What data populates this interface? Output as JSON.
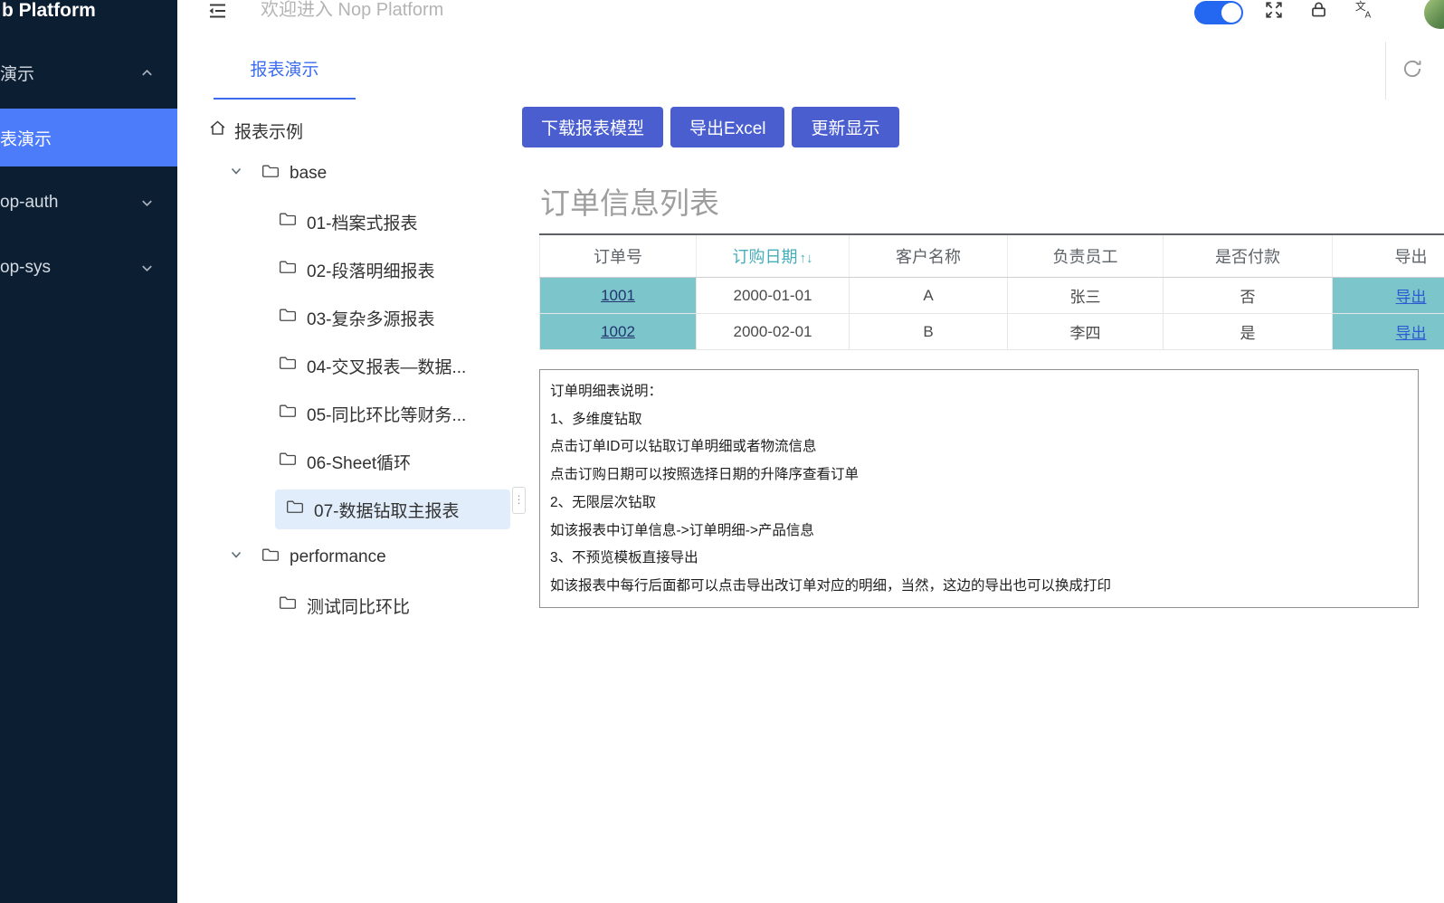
{
  "colors": {
    "sidebar_bg": "#0c1e32",
    "sidebar_active": "#4c7cfa",
    "primary_button": "#4b5ed0",
    "tab_accent": "#3b6cf0",
    "teal_cell": "#7cc5cb",
    "teal_header_text": "#45aeb8",
    "toggle_on": "#2468f2"
  },
  "sidebar": {
    "title": "b Platform",
    "items": [
      {
        "label": "演示",
        "state": "expanded"
      },
      {
        "label": "表演示",
        "state": "active"
      },
      {
        "label": "op-auth",
        "state": "collapsed"
      },
      {
        "label": "op-sys",
        "state": "collapsed"
      }
    ]
  },
  "header": {
    "welcome": "欢迎进入 Nop Platform"
  },
  "tabs": [
    {
      "label": "报表演示",
      "active": true
    }
  ],
  "tree": {
    "root": "报表示例",
    "folders": [
      {
        "label": "base",
        "expanded": true,
        "children": [
          "01-档案式报表",
          "02-段落明细报表",
          "03-复杂多源报表",
          "04-交叉报表—数据...",
          "05-同比环比等财务...",
          "06-Sheet循环",
          "07-数据钻取主报表"
        ],
        "selected_child": "07-数据钻取主报表"
      },
      {
        "label": "performance",
        "expanded": true,
        "children": [
          "测试同比环比"
        ]
      }
    ]
  },
  "toolbar": {
    "buttons": [
      "下载报表模型",
      "导出Excel",
      "更新显示"
    ]
  },
  "report": {
    "title": "订单信息列表",
    "table": {
      "headers": [
        "订单号",
        "订购日期",
        "客户名称",
        "负责员工",
        "是否付款",
        "导出"
      ],
      "sort_glyph": "↑↓",
      "rows": [
        {
          "order_id": "1001",
          "order_date": "2000-01-01",
          "customer": "A",
          "employee": "张三",
          "paid": "否",
          "export": "导出"
        },
        {
          "order_id": "1002",
          "order_date": "2000-02-01",
          "customer": "B",
          "employee": "李四",
          "paid": "是",
          "export": "导出"
        }
      ]
    },
    "description": [
      "订单明细表说明：",
      "1、多维度钻取",
      "点击订单ID可以钻取订单明细或者物流信息",
      "点击订购日期可以按照选择日期的升降序查看订单",
      "2、无限层次钻取",
      "如该报表中订单信息->订单明细->产品信息",
      "3、不预览模板直接导出",
      "如该报表中每行后面都可以点击导出改订单对应的明细，当然，这边的导出也可以换成打印"
    ]
  }
}
